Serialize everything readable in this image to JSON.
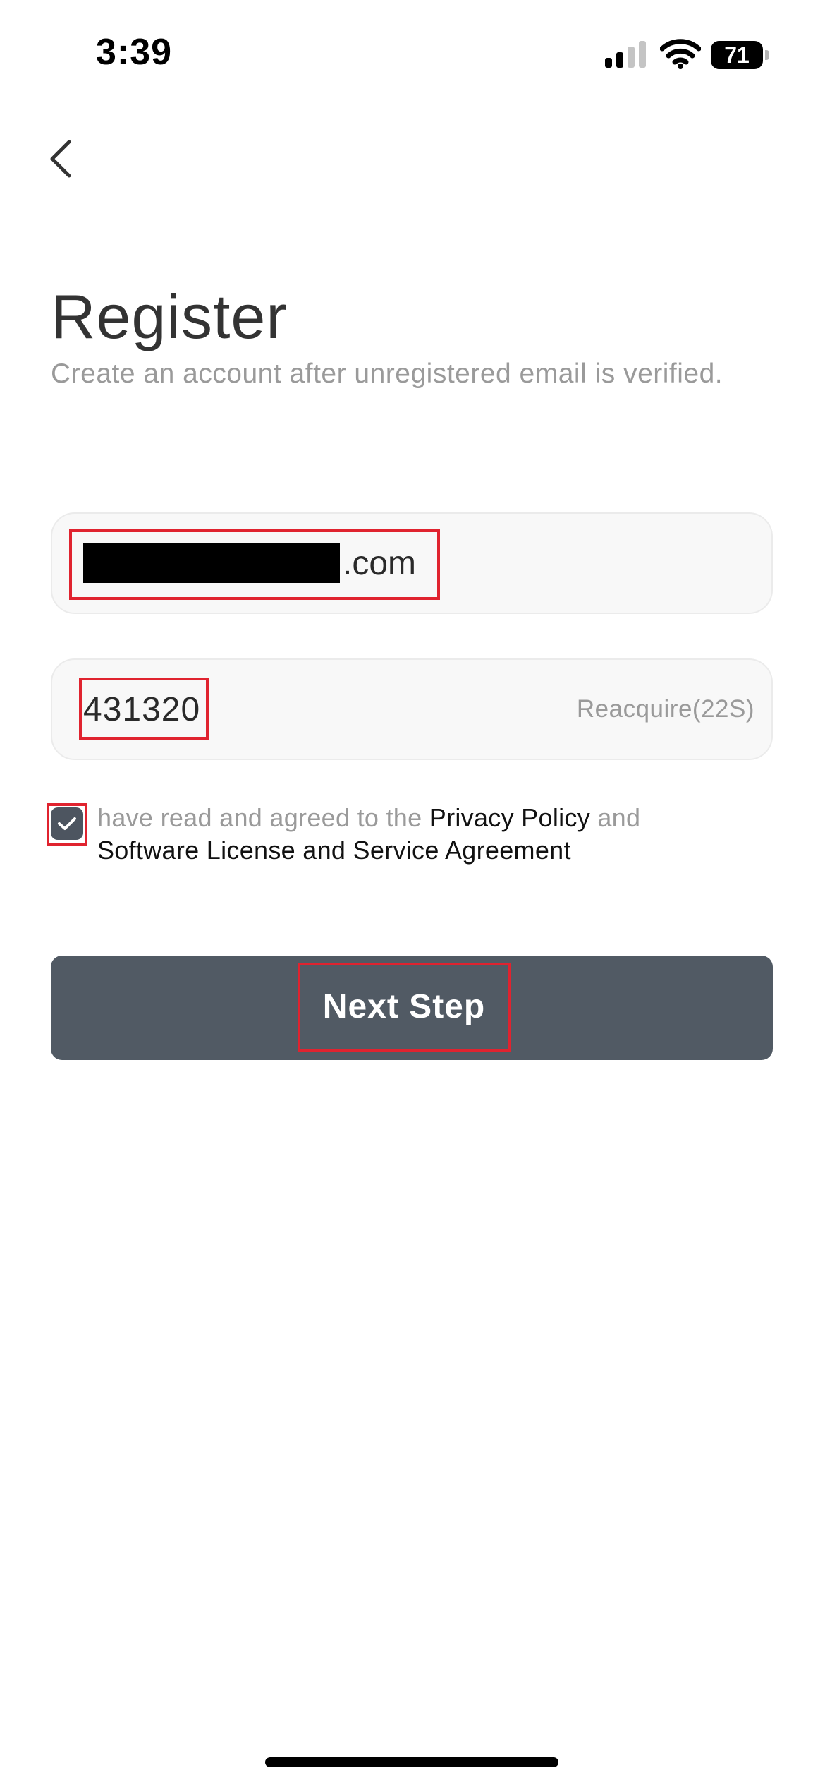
{
  "status_bar": {
    "time": "3:39",
    "battery_level": "71",
    "signal_strength_bars": 2,
    "signal_total_bars": 4
  },
  "header": {
    "back_icon": "chevron-left-icon"
  },
  "register": {
    "title": "Register",
    "subtitle": "Create an account after unregistered email is verified."
  },
  "email_field": {
    "value_visible_suffix": ".com",
    "redacted": true
  },
  "code_field": {
    "value": "431320",
    "resend_label": "Reacquire(22S)"
  },
  "agreement": {
    "checked": true,
    "prefix": "have read and agreed to the ",
    "privacy_link": "Privacy Policy",
    "middle": " and",
    "license_link": "Software License and Service Agreement"
  },
  "next_button": {
    "label": "Next Step"
  },
  "colors": {
    "button_bg": "#515a64",
    "checkbox_bg": "#4d5560",
    "highlight": "#e0232f",
    "muted_text": "#9a9a9a"
  }
}
